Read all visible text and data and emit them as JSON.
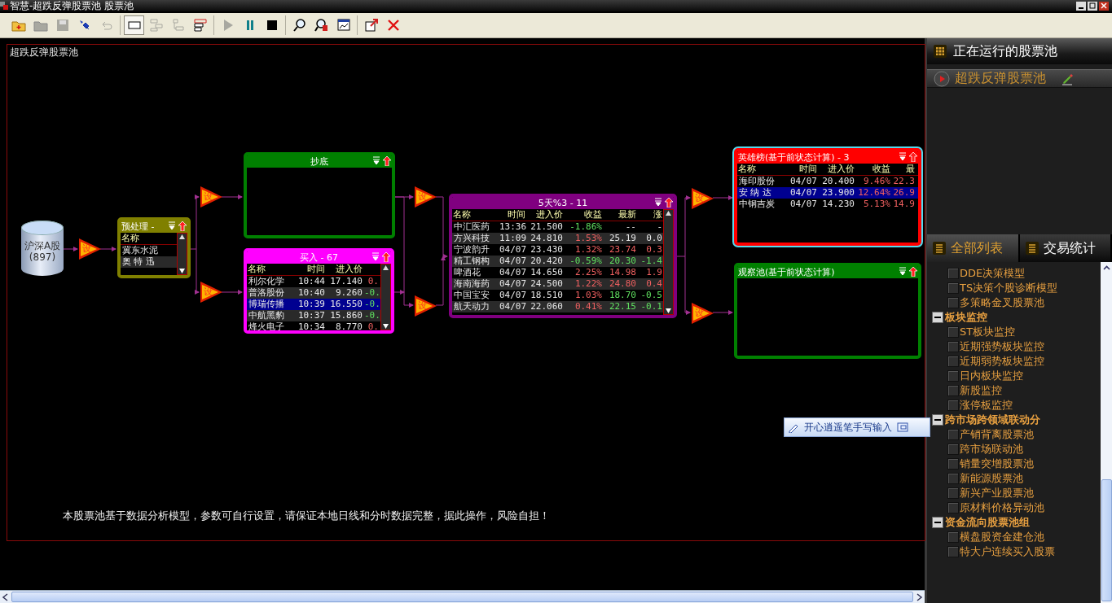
{
  "window": {
    "title": "智慧-超跌反弹股票池 股票池"
  },
  "toolbar": [
    [
      {
        "kind": "add-folder",
        "disabled": false,
        "selected": false
      },
      {
        "kind": "folder",
        "disabled": true,
        "selected": false
      },
      {
        "kind": "save",
        "disabled": true,
        "selected": false
      },
      {
        "kind": "pin",
        "disabled": false,
        "selected": false
      },
      {
        "kind": "undo",
        "disabled": true,
        "selected": false
      }
    ],
    [
      {
        "kind": "box",
        "disabled": false,
        "selected": true
      },
      {
        "kind": "tree-h",
        "disabled": true,
        "selected": false
      },
      {
        "kind": "tree-v",
        "disabled": true,
        "selected": false
      },
      {
        "kind": "stack",
        "disabled": false,
        "selected": false
      }
    ],
    [
      {
        "kind": "play",
        "disabled": true,
        "selected": false
      },
      {
        "kind": "pause",
        "disabled": false,
        "selected": false
      },
      {
        "kind": "stop",
        "disabled": false,
        "selected": false
      }
    ],
    [
      {
        "kind": "search",
        "disabled": false,
        "selected": false
      },
      {
        "kind": "search-doc",
        "disabled": false,
        "selected": false
      },
      {
        "kind": "chart-window",
        "disabled": false,
        "selected": false
      }
    ],
    [
      {
        "kind": "export",
        "disabled": false,
        "selected": false
      },
      {
        "kind": "close",
        "disabled": false,
        "selected": false
      }
    ]
  ],
  "canvas": {
    "title": "超跌反弹股票池",
    "source": {
      "label": "沪深A股",
      "count": "(897)"
    },
    "filters": [
      {
        "label": "设"
      },
      {
        "label": "设"
      },
      {
        "label": "设"
      },
      {
        "label": "设"
      },
      {
        "label": "设"
      },
      {
        "label": "设"
      },
      {
        "label": "设"
      }
    ],
    "nodes": [
      {
        "title": "预处理 -",
        "color": "#808000",
        "focused": false,
        "columns": [
          "名称"
        ],
        "rows": [
          {
            "cells": [
              "冀东水泥"
            ],
            "selected": false
          },
          {
            "cells": [
              "奥 特 迅"
            ],
            "selected": false
          }
        ]
      },
      {
        "title": "抄底",
        "color": "#008000",
        "focused": false
      },
      {
        "title": "买入 - 67",
        "color": "#ff00ff",
        "focused": false,
        "columns": [
          "名称",
          "时间",
          "进入价"
        ],
        "rows": [
          {
            "cells": [
              "利尔化学",
              "10:44",
              "17.140",
              {
                "text": "0.",
                "rise": true
              }
            ],
            "selected": false
          },
          {
            "cells": [
              "普洛股份",
              "10:40",
              "9.260",
              {
                "text": "-0.",
                "rise": false
              }
            ],
            "selected": false
          },
          {
            "cells": [
              "博瑞传播",
              "10:39",
              "16.550",
              {
                "text": "-0.",
                "rise": false
              }
            ],
            "selected": true
          },
          {
            "cells": [
              "中航黑豹",
              "10:37",
              "15.860",
              {
                "text": "-0.",
                "rise": false
              }
            ],
            "selected": false
          },
          {
            "cells": [
              "烽火电子",
              "10:34",
              "8.770",
              {
                "text": "0.",
                "rise": true
              }
            ],
            "selected": false
          }
        ]
      },
      {
        "title": "5天%3 - 11",
        "color": "#800080",
        "focused": false,
        "columns": [
          "名称",
          "时间",
          "进入价",
          "收益",
          "最新",
          "涨"
        ],
        "rows": [
          {
            "cells": [
              "中汇医药",
              "13:36",
              "21.500",
              {
                "text": "-1.86%",
                "rise": false
              },
              "--",
              "-"
            ],
            "selected": false
          },
          {
            "cells": [
              "方兴科技",
              "11:09",
              "24.810",
              {
                "text": "1.53%",
                "rise": true
              },
              "25.19",
              "0.0"
            ],
            "selected": false
          },
          {
            "cells": [
              "宁波韵升",
              "04/07",
              "23.430",
              {
                "text": "1.32%",
                "rise": true
              },
              {
                "text": "23.74",
                "rise": true
              },
              {
                "text": "0.3",
                "rise": true
              }
            ],
            "selected": false
          },
          {
            "cells": [
              "精工钢构",
              "04/07",
              "20.420",
              {
                "text": "-0.59%",
                "rise": false
              },
              {
                "text": "20.30",
                "rise": false
              },
              {
                "text": "-1.4",
                "rise": false
              }
            ],
            "selected": false
          },
          {
            "cells": [
              "啤酒花",
              "04/07",
              "14.650",
              {
                "text": "2.25%",
                "rise": true
              },
              {
                "text": "14.98",
                "rise": true
              },
              {
                "text": "1.9",
                "rise": true
              }
            ],
            "selected": false
          },
          {
            "cells": [
              "海南海药",
              "04/07",
              "24.500",
              {
                "text": "1.22%",
                "rise": true
              },
              {
                "text": "24.80",
                "rise": true
              },
              {
                "text": "0.4",
                "rise": true
              }
            ],
            "selected": false
          },
          {
            "cells": [
              "中国宝安",
              "04/07",
              "18.510",
              {
                "text": "1.03%",
                "rise": true
              },
              {
                "text": "18.70",
                "rise": false
              },
              {
                "text": "-0.5",
                "rise": false
              }
            ],
            "selected": false
          },
          {
            "cells": [
              "航天动力",
              "04/07",
              "22.060",
              {
                "text": "0.41%",
                "rise": true
              },
              {
                "text": "22.15",
                "rise": false
              },
              {
                "text": "-0.1",
                "rise": false
              }
            ],
            "selected": false
          }
        ]
      },
      {
        "title": "英雄榜(基于前状态计算) - 3",
        "color": "#ff0000",
        "focused": true,
        "columns": [
          "名称",
          "时间",
          "进入价",
          "收益",
          "最"
        ],
        "rows": [
          {
            "cells": [
              "海印股份",
              "04/07",
              "20.400",
              {
                "text": "9.46%",
                "rise": true
              },
              {
                "text": "22.3",
                "rise": true
              }
            ],
            "selected": false
          },
          {
            "cells": [
              "安 纳 达",
              "04/07",
              "23.900",
              {
                "text": "12.64%",
                "rise": true
              },
              {
                "text": "26.9",
                "rise": true
              }
            ],
            "selected": true
          },
          {
            "cells": [
              "中钢吉炭",
              "04/07",
              "14.230",
              {
                "text": "5.13%",
                "rise": true
              },
              {
                "text": "14.9",
                "rise": true
              }
            ],
            "selected": false
          }
        ]
      },
      {
        "title": "观察池(基于前状态计算)",
        "color": "#008000",
        "focused": false
      }
    ],
    "footnote": "本股票池基于数据分析模型，参数可自行设置，请保证本地日线和分时数据完整，据此操作，风险自担！"
  },
  "sidebar": {
    "running_title": "正在运行的股票池",
    "running": [
      {
        "label": "超跌反弹股票池"
      }
    ],
    "tabs": [
      {
        "label": "全部列表",
        "selected": true
      },
      {
        "label": "交易统计",
        "selected": false
      }
    ],
    "tree": [
      {
        "children": [
          {
            "label": "DDE决策模型",
            "checked": false
          },
          {
            "label": "TS决策个股诊断模型",
            "checked": false
          },
          {
            "label": "多策略金叉股票池",
            "checked": false
          }
        ]
      },
      {
        "label": "板块监控",
        "expanded": true,
        "children": [
          {
            "label": "ST板块监控",
            "checked": false
          },
          {
            "label": "近期强势板块监控",
            "checked": false
          },
          {
            "label": "近期弱势板块监控",
            "checked": false
          },
          {
            "label": "日内板块监控",
            "checked": false
          },
          {
            "label": "新股监控",
            "checked": false
          },
          {
            "label": "涨停板监控",
            "checked": false
          }
        ]
      },
      {
        "label": "跨市场跨领域联动分",
        "expanded": true,
        "children": [
          {
            "label": "产销背离股票池",
            "checked": false
          },
          {
            "label": "跨市场联动池",
            "checked": false
          },
          {
            "label": "销量突增股票池",
            "checked": false
          },
          {
            "label": "新能源股票池",
            "checked": false
          },
          {
            "label": "新兴产业股票池",
            "checked": false
          },
          {
            "label": "原材料价格异动池",
            "checked": false
          }
        ]
      },
      {
        "label": "资金流向股票池组",
        "expanded": true,
        "children": [
          {
            "label": "横盘股资金建仓池",
            "checked": false
          },
          {
            "label": "特大户连续买入股票",
            "checked": false
          }
        ]
      }
    ]
  },
  "ime_bar": {
    "label": "开心逍遥笔手写输入"
  }
}
